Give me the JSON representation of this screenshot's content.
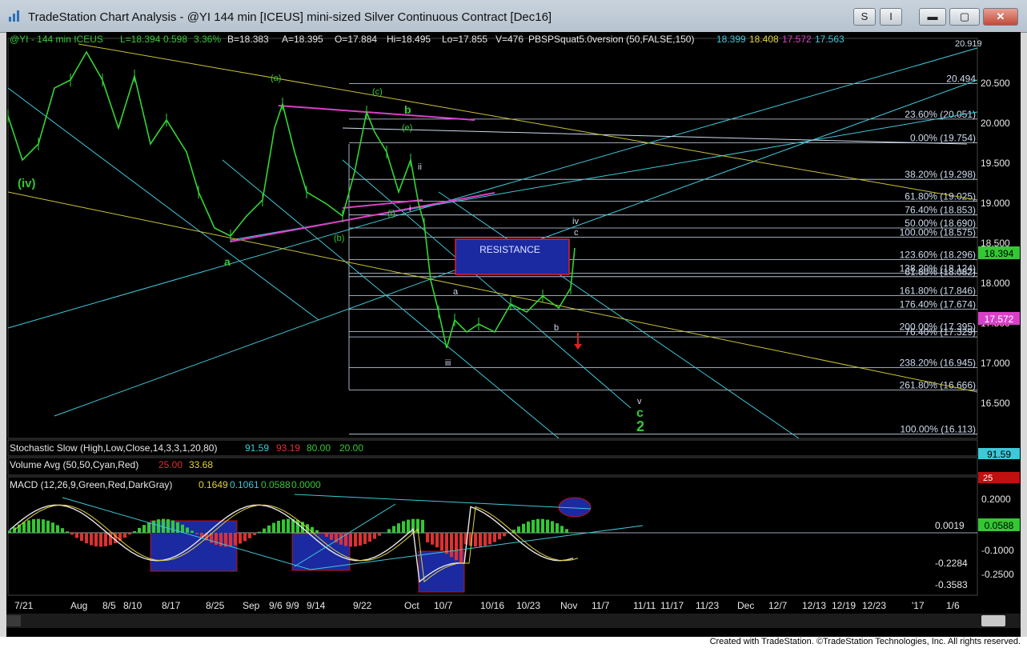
{
  "window": {
    "title": "TradeStation Chart Analysis - @YI 144 min [ICEUS] mini-sized Silver Continuous Contract [Dec16]",
    "btn_s": "S",
    "btn_i": "I",
    "btn_minimize": "▬",
    "btn_maximize": "▢",
    "btn_close": "✕"
  },
  "status_line": {
    "symbol": "@YI - 144 min  ICEUS",
    "last": "L=18.394",
    "change": "0.598",
    "pct": "3.36%",
    "bid": "B=18.383",
    "ask": "A=18.395",
    "open": "O=17.884",
    "high": "Hi=18.495",
    "low": "Lo=17.855",
    "vol": "V=476",
    "study": "PBSPSquat5.0version (50,FALSE,150)",
    "v1": "18.399",
    "v2": "18.408",
    "v3": "17.572",
    "v4": "17.563"
  },
  "colors": {
    "price": "#33d633",
    "cyan": "#3ec8d8",
    "yellow": "#c8c23a",
    "magenta": "#d940c8",
    "fib": "#cfdcef",
    "resistance": "#1b2aa0",
    "green_label": "#33c833"
  },
  "price_axis": {
    "ticks": [
      "20.500",
      "20.000",
      "19.500",
      "19.000",
      "18.500",
      "18.000",
      "17.500",
      "17.000",
      "16.500"
    ],
    "current_price": "18.394",
    "magenta_price": "17.572",
    "top_cut": "20.919"
  },
  "fib_levels": [
    {
      "label": "20.494",
      "val": 20.494
    },
    {
      "label": "23.60% (20.051)",
      "val": 20.051
    },
    {
      "label": "0.00% (19.754)",
      "val": 19.754
    },
    {
      "label": "38.20% (19.298)",
      "val": 19.298
    },
    {
      "label": "61.80% (19.025)",
      "val": 19.025
    },
    {
      "label": "76.40% (18.853)",
      "val": 18.853
    },
    {
      "label": "50.00% (18.690)",
      "val": 18.69
    },
    {
      "label": "100.00% (18.575)",
      "val": 18.575
    },
    {
      "label": "123.60% (18.296)",
      "val": 18.296
    },
    {
      "label": "138.20% (18.124)",
      "val": 18.124
    },
    {
      "label": "61.80% (18.082)",
      "val": 18.082
    },
    {
      "label": "161.80% (17.846)",
      "val": 17.846
    },
    {
      "label": "176.40% (17.674)",
      "val": 17.674
    },
    {
      "label": "200.00% (17.395)",
      "val": 17.395
    },
    {
      "label": "76.40% (17.329)",
      "val": 17.329
    },
    {
      "label": "238.20% (16.945)",
      "val": 16.945
    },
    {
      "label": "261.80% (16.666)",
      "val": 16.666
    },
    {
      "label": "100.00% (16.113)",
      "val": 16.113
    }
  ],
  "resistance_label": "RESISTANCE",
  "wave_labels": {
    "iv_big": "(iv)",
    "a_low": "a",
    "a_paren": "(a)",
    "b_paren": "(b)",
    "c_paren": "(c)",
    "b_green": "b",
    "e_paren": "(e)",
    "ii": "ii",
    "i_paren": "(i)",
    "i": "i",
    "a_small": "a",
    "b_small": "b",
    "iii": "iii",
    "iv_small": "iv",
    "c_small": "c",
    "v_small": "v",
    "c_big": "c",
    "two_big": "2"
  },
  "stoch": {
    "label": "Stochastic Slow (High,Low,Close,14,3,3,1,20,80)",
    "v1": "91.59",
    "v2": "93.19",
    "v3": "80.00",
    "v4": "20.00",
    "axis_value": "91.59"
  },
  "volume": {
    "label": "Volume Avg (50,50,Cyan,Red)",
    "v1": "25.00",
    "v2": "33.68",
    "axis_value": "25"
  },
  "macd": {
    "label": "MACD (12,26,9,Green,Red,DarkGray)",
    "v1": "0.1649",
    "v2": "0.1061",
    "v3": "0.0588",
    "v4": "0.0000",
    "ticks": [
      "0.2000",
      "0.0019",
      "-0.1000",
      "-0.2284",
      "-0.2500",
      "-0.3583"
    ],
    "axis_value": "0.0588"
  },
  "date_axis": [
    "7/21",
    "Aug",
    "8/5",
    "8/10",
    "8/17",
    "8/25",
    "Sep",
    "9/6",
    "9/9",
    "9/14",
    "9/22",
    "Oct",
    "10/7",
    "10/16",
    "10/23",
    "Nov",
    "11/7",
    "11/11",
    "11/17",
    "11/23",
    "Dec",
    "12/7",
    "12/13",
    "12/19",
    "12/23",
    "'17",
    "1/6"
  ],
  "footer": "Created with TradeStation. ©TradeStation Technologies, Inc. All rights reserved.",
  "chart_data": {
    "type": "line",
    "title": "@YI 144 min [ICEUS] mini-sized Silver Continuous Contract [Dec16]",
    "y_range": [
      16.1,
      20.9
    ],
    "close_series_approx": [
      {
        "x": "7/21",
        "y": 19.6
      },
      {
        "x": "Aug",
        "y": 20.5
      },
      {
        "x": "8/5",
        "y": 20.0
      },
      {
        "x": "8/10",
        "y": 20.2
      },
      {
        "x": "8/17",
        "y": 19.4
      },
      {
        "x": "8/25",
        "y": 18.6
      },
      {
        "x": "Sep",
        "y": 18.9
      },
      {
        "x": "9/6",
        "y": 20.1
      },
      {
        "x": "9/9",
        "y": 19.3
      },
      {
        "x": "9/14",
        "y": 19.1
      },
      {
        "x": "9/22",
        "y": 20.0
      },
      {
        "x": "Oct",
        "y": 18.9
      },
      {
        "x": "10/7",
        "y": 17.3
      },
      {
        "x": "10/16",
        "y": 17.5
      },
      {
        "x": "10/23",
        "y": 17.7
      },
      {
        "x": "Nov",
        "y": 18.39
      }
    ]
  }
}
